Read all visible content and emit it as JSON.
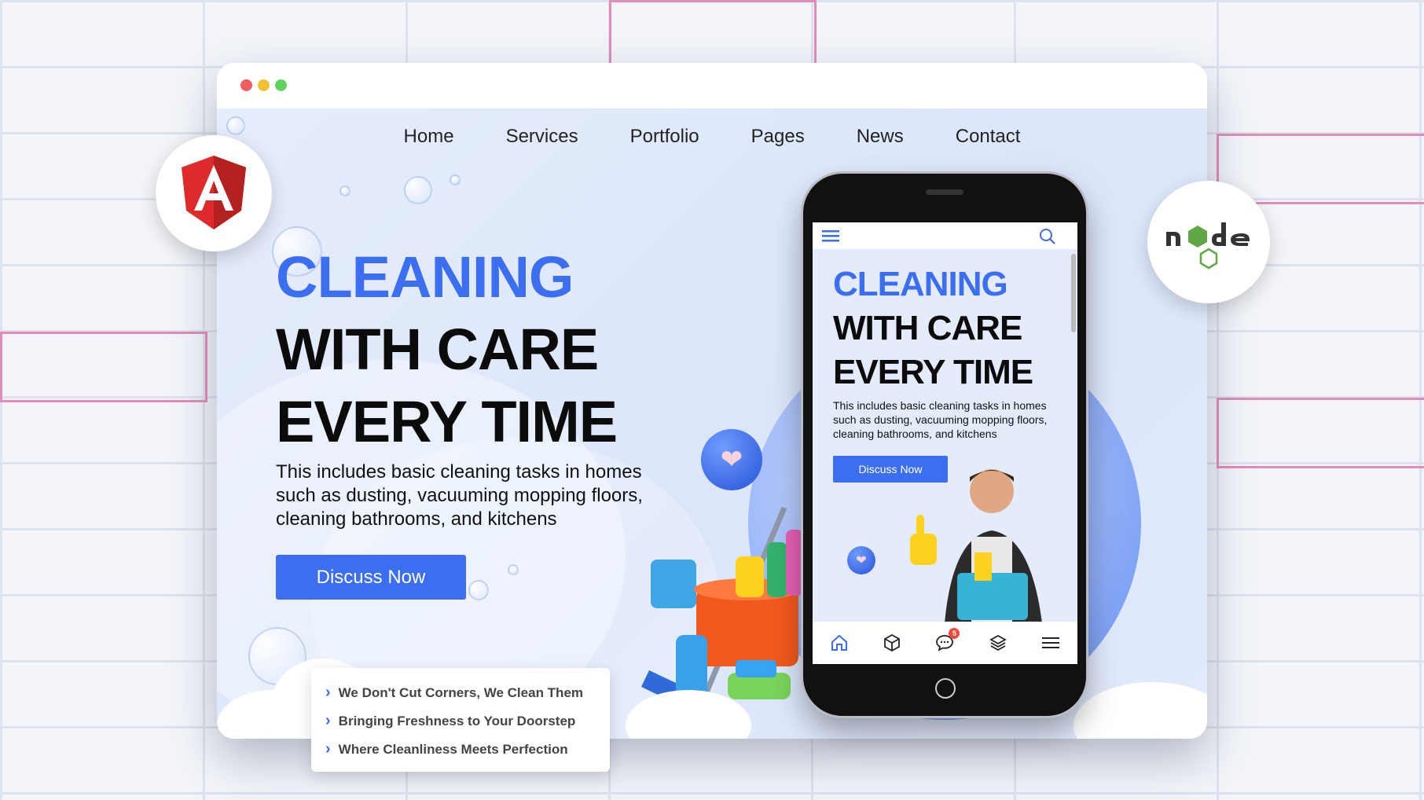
{
  "nav": {
    "items": [
      "Home",
      "Services",
      "Portfolio",
      "Pages",
      "News",
      "Contact"
    ]
  },
  "hero": {
    "line1": "CLEANING",
    "line2": "WITH CARE",
    "line3": "EVERY TIME",
    "description": "This includes basic cleaning tasks in homes such as dusting, vacuuming mopping floors, cleaning bathrooms, and kitchens",
    "cta_label": "Discuss Now"
  },
  "phone": {
    "line1": "CLEANING",
    "line2": "WITH CARE",
    "line3": "EVERY TIME",
    "description": "This includes basic cleaning tasks in homes such as dusting, vacuuming mopping floors, cleaning bathrooms, and kitchens",
    "cta_label": "Discuss Now",
    "chat_badge": "5",
    "bottom_icons": [
      "home-icon",
      "box-icon",
      "chat-icon",
      "layers-icon",
      "menu-icon"
    ]
  },
  "features": {
    "items": [
      "We Don't Cut Corners, We Clean Them",
      "Bringing Freshness to Your Doorstep",
      "Where Cleanliness Meets Perfection"
    ]
  },
  "logos": {
    "angular": "angular-logo",
    "node": "nodejs-logo"
  },
  "colors": {
    "accent": "#3b6ef0",
    "window_dot_red": "#f25b5b",
    "window_dot_yellow": "#f2c232",
    "window_dot_green": "#5fd35f"
  }
}
